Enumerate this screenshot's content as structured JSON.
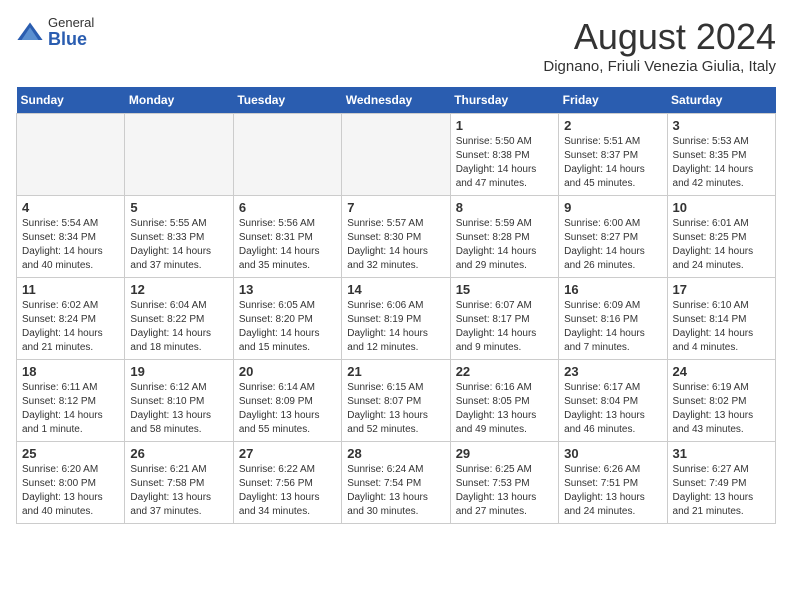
{
  "logo": {
    "general": "General",
    "blue": "Blue"
  },
  "title": "August 2024",
  "location": "Dignano, Friuli Venezia Giulia, Italy",
  "days_of_week": [
    "Sunday",
    "Monday",
    "Tuesday",
    "Wednesday",
    "Thursday",
    "Friday",
    "Saturday"
  ],
  "weeks": [
    [
      {
        "day": "",
        "empty": true
      },
      {
        "day": "",
        "empty": true
      },
      {
        "day": "",
        "empty": true
      },
      {
        "day": "",
        "empty": true
      },
      {
        "day": "1",
        "sunrise": "5:50 AM",
        "sunset": "8:38 PM",
        "daylight": "14 hours and 47 minutes."
      },
      {
        "day": "2",
        "sunrise": "5:51 AM",
        "sunset": "8:37 PM",
        "daylight": "14 hours and 45 minutes."
      },
      {
        "day": "3",
        "sunrise": "5:53 AM",
        "sunset": "8:35 PM",
        "daylight": "14 hours and 42 minutes."
      }
    ],
    [
      {
        "day": "4",
        "sunrise": "5:54 AM",
        "sunset": "8:34 PM",
        "daylight": "14 hours and 40 minutes."
      },
      {
        "day": "5",
        "sunrise": "5:55 AM",
        "sunset": "8:33 PM",
        "daylight": "14 hours and 37 minutes."
      },
      {
        "day": "6",
        "sunrise": "5:56 AM",
        "sunset": "8:31 PM",
        "daylight": "14 hours and 35 minutes."
      },
      {
        "day": "7",
        "sunrise": "5:57 AM",
        "sunset": "8:30 PM",
        "daylight": "14 hours and 32 minutes."
      },
      {
        "day": "8",
        "sunrise": "5:59 AM",
        "sunset": "8:28 PM",
        "daylight": "14 hours and 29 minutes."
      },
      {
        "day": "9",
        "sunrise": "6:00 AM",
        "sunset": "8:27 PM",
        "daylight": "14 hours and 26 minutes."
      },
      {
        "day": "10",
        "sunrise": "6:01 AM",
        "sunset": "8:25 PM",
        "daylight": "14 hours and 24 minutes."
      }
    ],
    [
      {
        "day": "11",
        "sunrise": "6:02 AM",
        "sunset": "8:24 PM",
        "daylight": "14 hours and 21 minutes."
      },
      {
        "day": "12",
        "sunrise": "6:04 AM",
        "sunset": "8:22 PM",
        "daylight": "14 hours and 18 minutes."
      },
      {
        "day": "13",
        "sunrise": "6:05 AM",
        "sunset": "8:20 PM",
        "daylight": "14 hours and 15 minutes."
      },
      {
        "day": "14",
        "sunrise": "6:06 AM",
        "sunset": "8:19 PM",
        "daylight": "14 hours and 12 minutes."
      },
      {
        "day": "15",
        "sunrise": "6:07 AM",
        "sunset": "8:17 PM",
        "daylight": "14 hours and 9 minutes."
      },
      {
        "day": "16",
        "sunrise": "6:09 AM",
        "sunset": "8:16 PM",
        "daylight": "14 hours and 7 minutes."
      },
      {
        "day": "17",
        "sunrise": "6:10 AM",
        "sunset": "8:14 PM",
        "daylight": "14 hours and 4 minutes."
      }
    ],
    [
      {
        "day": "18",
        "sunrise": "6:11 AM",
        "sunset": "8:12 PM",
        "daylight": "14 hours and 1 minute."
      },
      {
        "day": "19",
        "sunrise": "6:12 AM",
        "sunset": "8:10 PM",
        "daylight": "13 hours and 58 minutes."
      },
      {
        "day": "20",
        "sunrise": "6:14 AM",
        "sunset": "8:09 PM",
        "daylight": "13 hours and 55 minutes."
      },
      {
        "day": "21",
        "sunrise": "6:15 AM",
        "sunset": "8:07 PM",
        "daylight": "13 hours and 52 minutes."
      },
      {
        "day": "22",
        "sunrise": "6:16 AM",
        "sunset": "8:05 PM",
        "daylight": "13 hours and 49 minutes."
      },
      {
        "day": "23",
        "sunrise": "6:17 AM",
        "sunset": "8:04 PM",
        "daylight": "13 hours and 46 minutes."
      },
      {
        "day": "24",
        "sunrise": "6:19 AM",
        "sunset": "8:02 PM",
        "daylight": "13 hours and 43 minutes."
      }
    ],
    [
      {
        "day": "25",
        "sunrise": "6:20 AM",
        "sunset": "8:00 PM",
        "daylight": "13 hours and 40 minutes."
      },
      {
        "day": "26",
        "sunrise": "6:21 AM",
        "sunset": "7:58 PM",
        "daylight": "13 hours and 37 minutes."
      },
      {
        "day": "27",
        "sunrise": "6:22 AM",
        "sunset": "7:56 PM",
        "daylight": "13 hours and 34 minutes."
      },
      {
        "day": "28",
        "sunrise": "6:24 AM",
        "sunset": "7:54 PM",
        "daylight": "13 hours and 30 minutes."
      },
      {
        "day": "29",
        "sunrise": "6:25 AM",
        "sunset": "7:53 PM",
        "daylight": "13 hours and 27 minutes."
      },
      {
        "day": "30",
        "sunrise": "6:26 AM",
        "sunset": "7:51 PM",
        "daylight": "13 hours and 24 minutes."
      },
      {
        "day": "31",
        "sunrise": "6:27 AM",
        "sunset": "7:49 PM",
        "daylight": "13 hours and 21 minutes."
      }
    ]
  ]
}
